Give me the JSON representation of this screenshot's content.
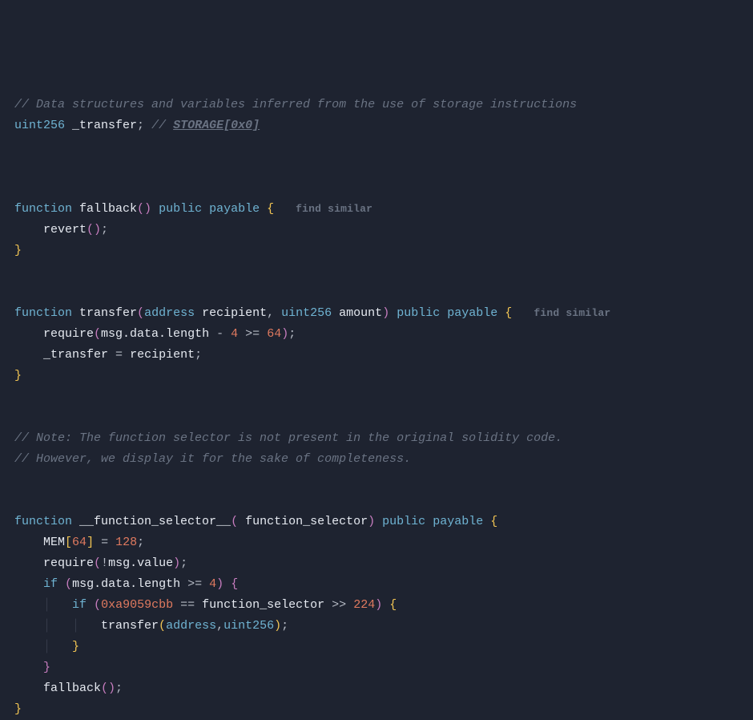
{
  "line1_comment": "// Data structures and variables inferred from the use of storage instructions",
  "decl": {
    "type": "uint256",
    "name": "_transfer",
    "comment_prefix": "//",
    "storage": "STORAGE[0x0]"
  },
  "fn_fallback": {
    "kw_function": "function",
    "name": "fallback",
    "kw_public": "public",
    "kw_payable": "payable",
    "hint": "find similar",
    "body_revert": "revert"
  },
  "fn_transfer": {
    "kw_function": "function",
    "name": "transfer",
    "p1_type": "address",
    "p1_name": "recipient",
    "p2_type": "uint256",
    "p2_name": "amount",
    "kw_public": "public",
    "kw_payable": "payable",
    "hint": "find similar",
    "req_call": "require",
    "req_target": "msg.data.length",
    "req_minus": "-",
    "req_four": "4",
    "req_ge": ">=",
    "req_sixtyfour": "64",
    "assign_lhs": "_transfer",
    "assign_eq": "=",
    "assign_rhs": "recipient"
  },
  "note1": "// Note: The function selector is not present in the original solidity code.",
  "note2": "// However, we display it for the sake of completeness.",
  "fn_selector": {
    "kw_function": "function",
    "name": "__function_selector__",
    "param_name": "function_selector",
    "kw_public": "public",
    "kw_payable": "payable",
    "mem": "MEM",
    "mem_idx": "64",
    "mem_val": "128",
    "req_call": "require",
    "bang": "!",
    "msg_value": "msg.value",
    "kw_if": "if",
    "cond1_lhs": "msg.data.length",
    "cond1_ge": ">=",
    "cond1_rhs": "4",
    "cond2_hex": "0xa9059cbb",
    "cond2_eq": "==",
    "cond2_rhs": "function_selector",
    "cond2_shift": ">>",
    "cond2_n": "224",
    "call_name": "transfer",
    "call_arg1": "address",
    "call_arg2": "uint256",
    "call_fallback": "fallback"
  }
}
